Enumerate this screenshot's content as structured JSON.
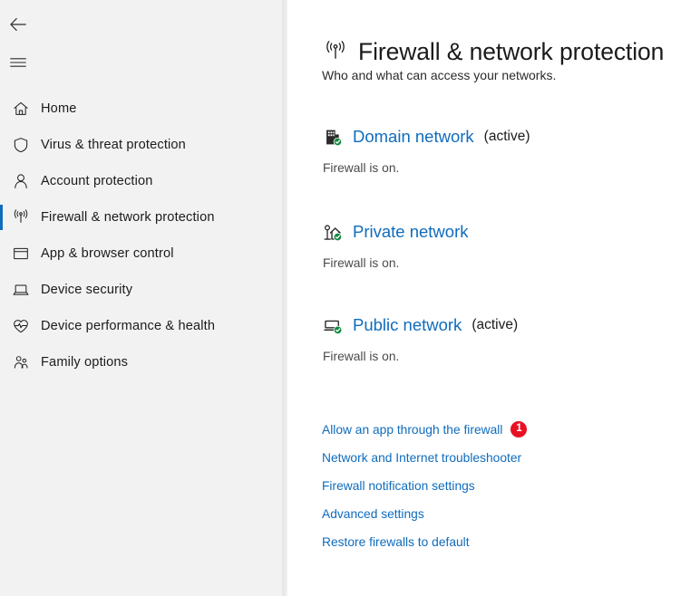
{
  "sidebar": {
    "back_icon": "back-arrow-icon",
    "menu_icon": "hamburger-menu-icon",
    "items": [
      {
        "label": "Home",
        "icon": "home-icon",
        "selected": false
      },
      {
        "label": "Virus & threat protection",
        "icon": "shield-icon",
        "selected": false
      },
      {
        "label": "Account protection",
        "icon": "person-icon",
        "selected": false
      },
      {
        "label": "Firewall & network protection",
        "icon": "wifi-broadcast-icon",
        "selected": true
      },
      {
        "label": "App & browser control",
        "icon": "window-icon",
        "selected": false
      },
      {
        "label": "Device security",
        "icon": "laptop-icon",
        "selected": false
      },
      {
        "label": "Device performance & health",
        "icon": "heart-pulse-icon",
        "selected": false
      },
      {
        "label": "Family options",
        "icon": "people-icon",
        "selected": false
      }
    ]
  },
  "header": {
    "icon": "wifi-broadcast-icon",
    "title": "Firewall & network protection",
    "subtitle": "Who and what can access your networks."
  },
  "networks": [
    {
      "icon": "building-check-icon",
      "name": "Domain network",
      "active_label": "(active)",
      "status": "Firewall is on."
    },
    {
      "icon": "house-tree-check-icon",
      "name": "Private network",
      "active_label": "",
      "status": "Firewall is on."
    },
    {
      "icon": "monitor-bench-check-icon",
      "name": "Public network",
      "active_label": "(active)",
      "status": "Firewall is on."
    }
  ],
  "links": [
    {
      "label": "Allow an app through the firewall",
      "badge": "1"
    },
    {
      "label": "Network and Internet troubleshooter",
      "badge": ""
    },
    {
      "label": "Firewall notification settings",
      "badge": ""
    },
    {
      "label": "Advanced settings",
      "badge": ""
    },
    {
      "label": "Restore firewalls to default",
      "badge": ""
    }
  ],
  "colors": {
    "link_blue": "#0f6cbd",
    "accent_blue": "#0f6cbd",
    "badge_red": "#e81123",
    "status_green": "#10893e",
    "sidebar_bg": "#f2f2f2"
  }
}
